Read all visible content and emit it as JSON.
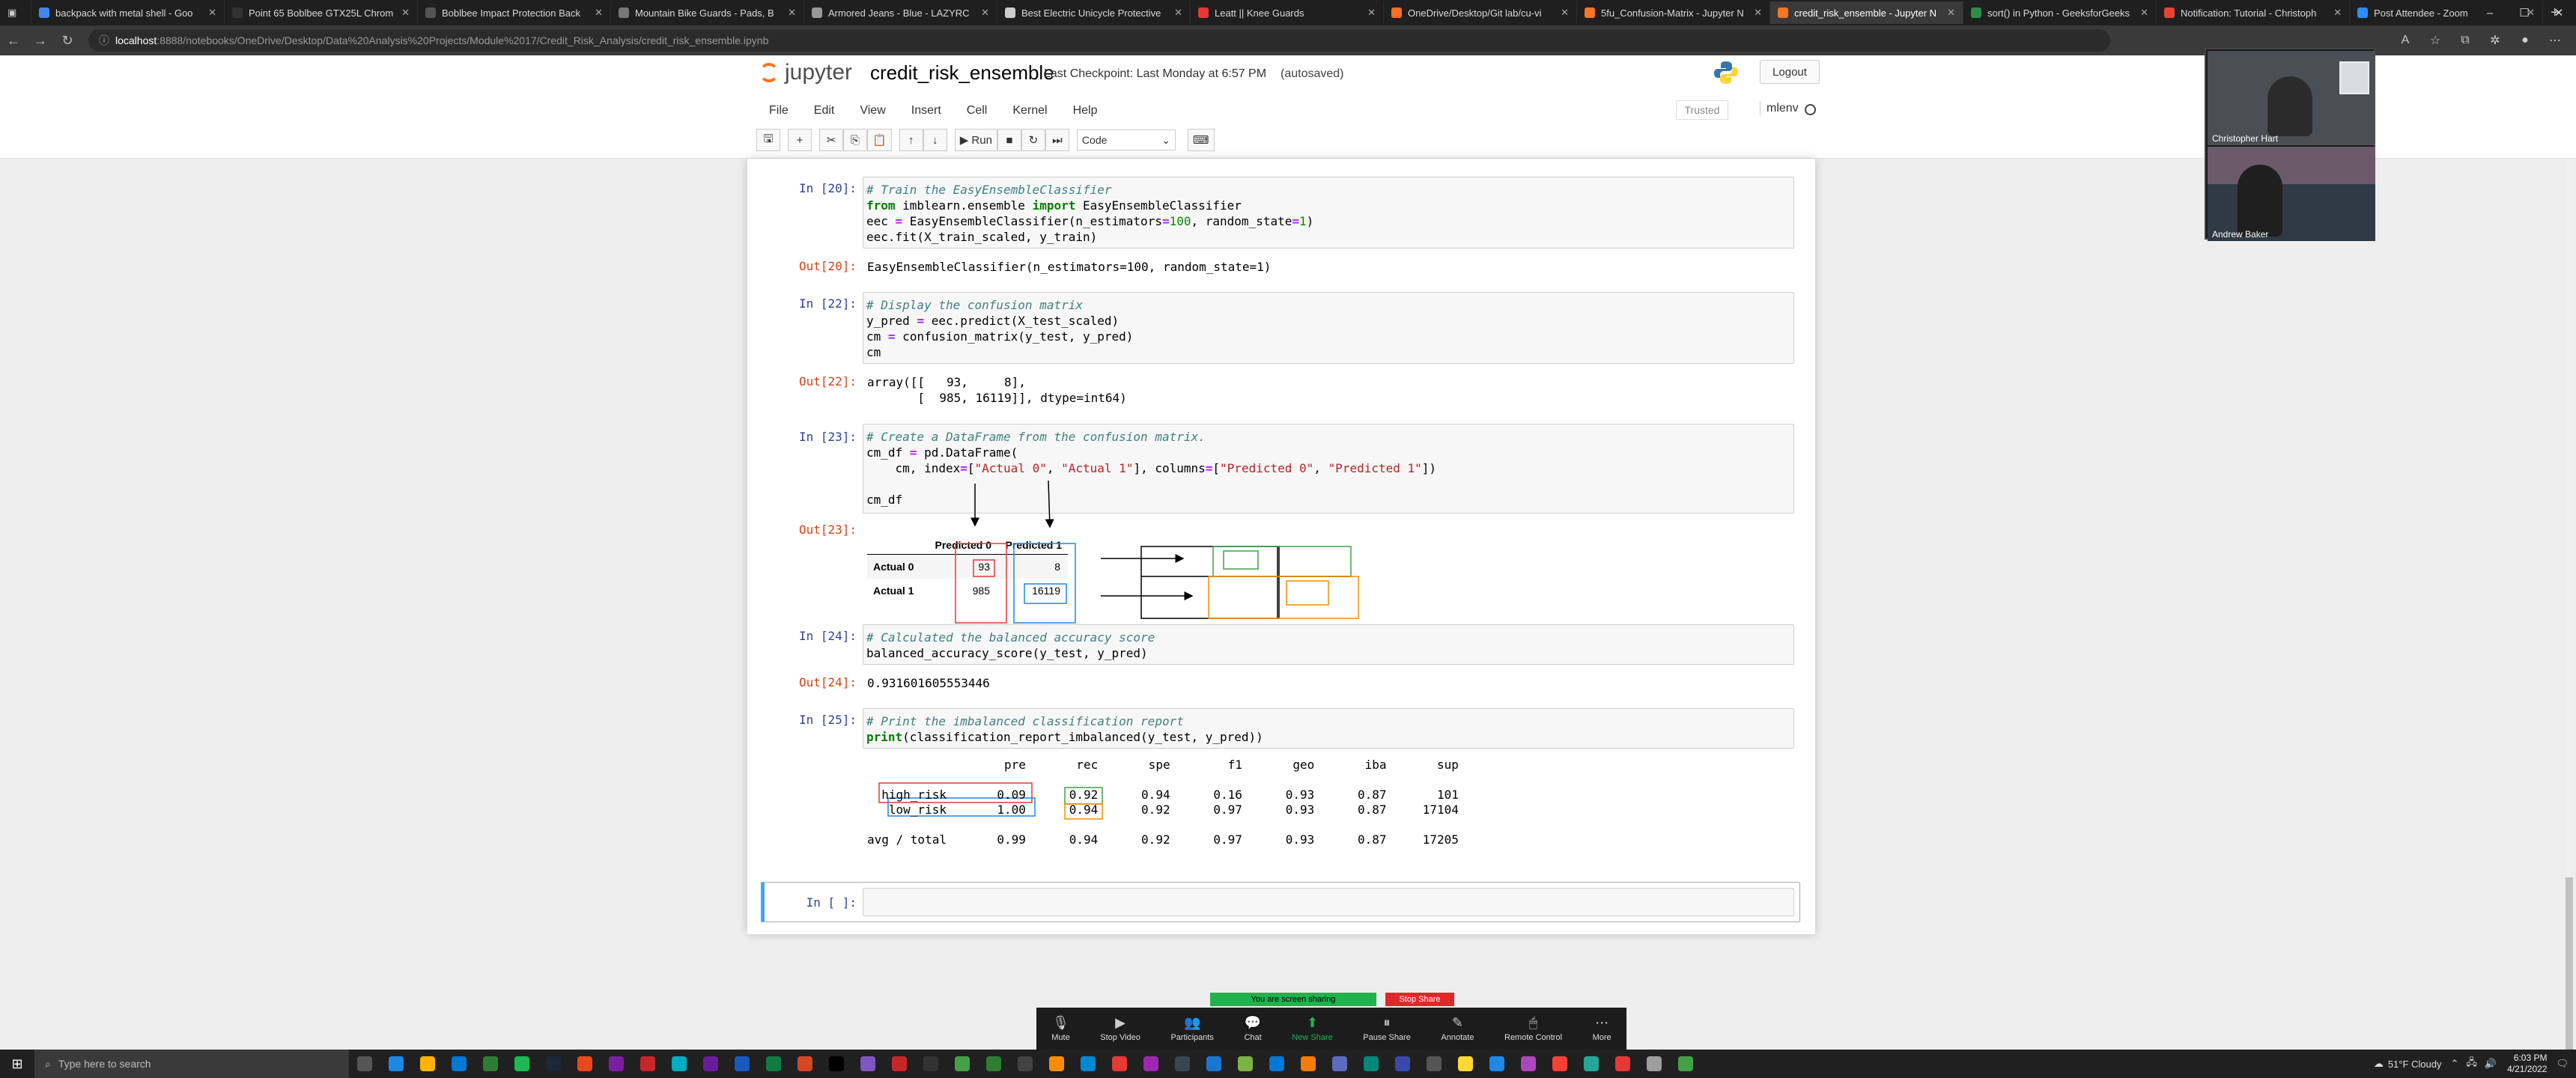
{
  "browser": {
    "tabs": [
      {
        "label": "backpack with metal shell - Goo",
        "color": "#4285f4",
        "active": false
      },
      {
        "label": "Point 65 Boblbee GTX25L Chrom",
        "color": "#333333",
        "active": false
      },
      {
        "label": "Boblbee Impact Protection Back",
        "color": "#555555",
        "active": false
      },
      {
        "label": "Mountain Bike Guards - Pads, B",
        "color": "#777777",
        "active": false
      },
      {
        "label": "Armored Jeans - Blue - LAZYRC",
        "color": "#999999",
        "active": false
      },
      {
        "label": "Best Electric Unicycle Protective",
        "color": "#cccccc",
        "active": false
      },
      {
        "label": "Leatt || Knee Guards",
        "color": "#e53935",
        "active": false
      },
      {
        "label": "OneDrive/Desktop/Git lab/cu-vi",
        "color": "#fc6d26",
        "active": false
      },
      {
        "label": "5fu_Confusion-Matrix - Jupyter N",
        "color": "#f37726",
        "active": false
      },
      {
        "label": "credit_risk_ensemble - Jupyter N",
        "color": "#f37726",
        "active": true
      },
      {
        "label": "sort() in Python - GeeksforGeeks",
        "color": "#2f8d46",
        "active": false
      },
      {
        "label": "Notification: Tutorial - Christoph",
        "color": "#ea4335",
        "active": false
      },
      {
        "label": "Post Attendee - Zoom",
        "color": "#2d8cff",
        "active": false
      }
    ],
    "new_tab": "+",
    "url_host": "localhost",
    "url_path": ":8888/notebooks/OneDrive/Desktop/Data%20Analysis%20Projects/Module%2017/Credit_Risk_Analysis/credit_risk_ensemble.ipynb"
  },
  "jupyter": {
    "logo_text": "jupyter",
    "notebook_name": "credit_risk_ensemble",
    "checkpoint": "Last Checkpoint: Last Monday at 6:57 PM",
    "autosaved": "(autosaved)",
    "logout": "Logout",
    "menus": [
      "File",
      "Edit",
      "View",
      "Insert",
      "Cell",
      "Kernel",
      "Help"
    ],
    "trusted": "Trusted",
    "kernel_name": "mlenv",
    "run_label": "Run",
    "cell_type": "Code"
  },
  "cells": {
    "c20": {
      "in_prompt": "In [20]:",
      "out_prompt": "Out[20]:",
      "output": "EasyEnsembleClassifier(n_estimators=100, random_state=1)"
    },
    "c22": {
      "in_prompt": "In [22]:",
      "out_prompt": "Out[22]:",
      "output": "array([[   93,     8],\n       [  985, 16119]], dtype=int64)"
    },
    "c23": {
      "in_prompt": "In [23]:",
      "out_prompt": "Out[23]:",
      "df_cols": [
        "Predicted 0",
        "Predicted 1"
      ],
      "df_rows": [
        {
          "label": "Actual 0",
          "values": [
            "93",
            "8"
          ]
        },
        {
          "label": "Actual 1",
          "values": [
            "985",
            "16119"
          ]
        }
      ]
    },
    "c24": {
      "in_prompt": "In [24]:",
      "out_prompt": "Out[24]:",
      "output": "0.931601605553446"
    },
    "c25": {
      "in_prompt": "In [25]:",
      "report": "                   pre       rec       spe        f1       geo       iba       sup\n\n  high_risk       0.09      0.92      0.94      0.16      0.93      0.87       101\n   low_risk       1.00      0.94      0.92      0.97      0.93      0.87     17104\n\navg / total       0.99      0.94      0.92      0.97      0.93      0.87     17205"
    },
    "empty": {
      "in_prompt": "In [ ]:"
    }
  },
  "zoom": {
    "participants": [
      {
        "name": "Christopher Hart"
      },
      {
        "name": "Andrew Baker"
      }
    ],
    "sharing_banner": "You are screen sharing",
    "stop_share": "Stop Share",
    "controls": [
      {
        "label": "Mute",
        "icon": "microphone-icon"
      },
      {
        "label": "Stop Video",
        "icon": "video-camera-icon"
      },
      {
        "label": "Participants",
        "icon": "participants-icon",
        "count": "2"
      },
      {
        "label": "Chat",
        "icon": "chat-icon"
      },
      {
        "label": "New Share",
        "icon": "share-icon"
      },
      {
        "label": "Pause Share",
        "icon": "pause-icon"
      },
      {
        "label": "Annotate",
        "icon": "pencil-icon"
      },
      {
        "label": "Remote Control",
        "icon": "mouse-icon"
      },
      {
        "label": "More",
        "icon": "more-icon"
      }
    ]
  },
  "taskbar": {
    "search_placeholder": "Type here to search",
    "weather": "51°F Cloudy",
    "time": "6:03 PM",
    "date": "4/21/2022"
  }
}
